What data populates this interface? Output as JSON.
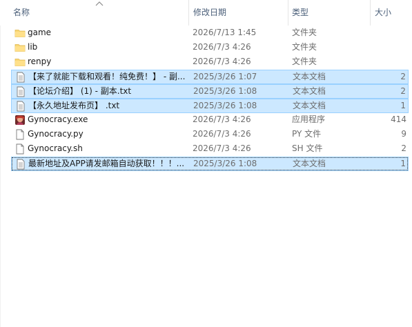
{
  "columns": {
    "name": "名称",
    "date": "修改日期",
    "type": "类型",
    "size": "大小"
  },
  "colors": {
    "selected_bg": "#cce8ff",
    "selected_border": "#99d1ff",
    "folder": "#f8d775",
    "header_text": "#4c607a"
  },
  "files": [
    {
      "icon": "folder-icon",
      "name": "game",
      "date": "2026/7/13 1:45",
      "type": "文件夹",
      "size": "",
      "selected": false
    },
    {
      "icon": "folder-icon",
      "name": "lib",
      "date": "2026/7/3 4:26",
      "type": "文件夹",
      "size": "",
      "selected": false
    },
    {
      "icon": "folder-icon",
      "name": "renpy",
      "date": "2026/7/3 4:26",
      "type": "文件夹",
      "size": "",
      "selected": false
    },
    {
      "icon": "text-file-icon",
      "name": "【来了就能下载和观看！纯免费！】 - 副...",
      "date": "2025/3/26 1:07",
      "type": "文本文档",
      "size": "2",
      "selected": true
    },
    {
      "icon": "text-file-icon",
      "name": "【论坛介绍】 (1) - 副本.txt",
      "date": "2025/3/26 1:08",
      "type": "文本文档",
      "size": "2",
      "selected": true
    },
    {
      "icon": "text-file-icon",
      "name": "【永久地址发布页】 .txt",
      "date": "2025/3/26 1:08",
      "type": "文本文档",
      "size": "1",
      "selected": true
    },
    {
      "icon": "exe-app-icon",
      "name": "Gynocracy.exe",
      "date": "2026/7/3 4:26",
      "type": "应用程序",
      "size": "414",
      "selected": false
    },
    {
      "icon": "generic-file-icon",
      "name": "Gynocracy.py",
      "date": "2026/7/3 4:26",
      "type": "PY 文件",
      "size": "9",
      "selected": false
    },
    {
      "icon": "generic-file-icon",
      "name": "Gynocracy.sh",
      "date": "2026/7/3 4:26",
      "type": "SH 文件",
      "size": "2",
      "selected": false
    },
    {
      "icon": "text-file-icon",
      "name": "最新地址及APP请发邮箱自动获取！！！...",
      "date": "2025/3/26 1:08",
      "type": "文本文档",
      "size": "1",
      "selected": true
    }
  ]
}
